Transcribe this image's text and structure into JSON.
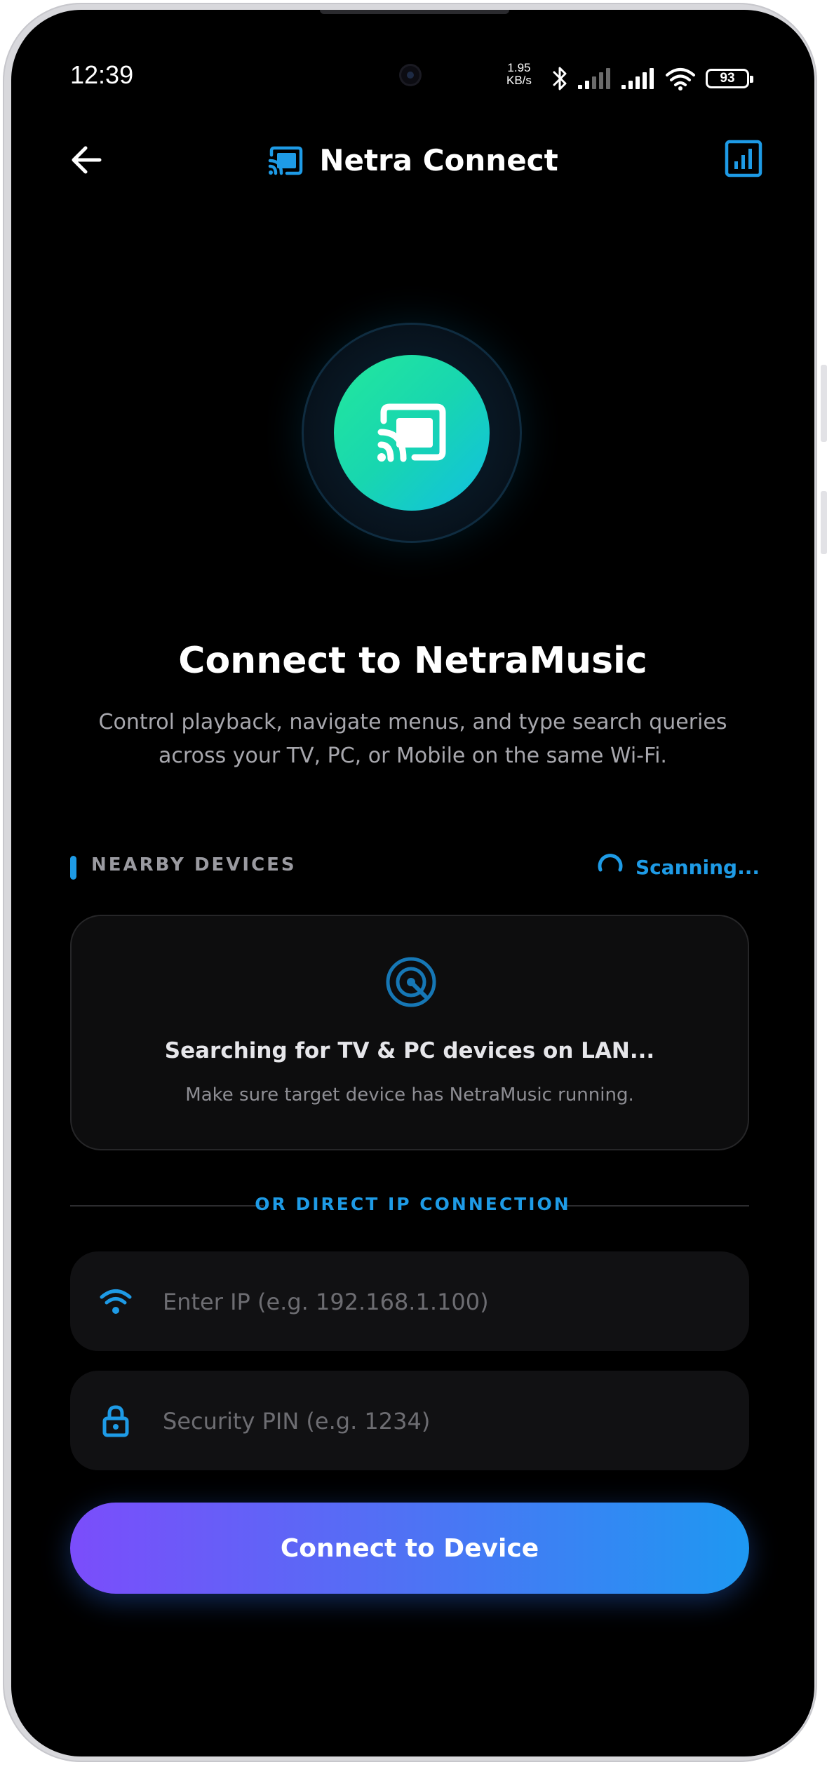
{
  "status_bar": {
    "time": "12:39",
    "net_speed_value": "1.95",
    "net_speed_unit": "KB/s",
    "battery": "93"
  },
  "app_bar": {
    "title": "Netra Connect"
  },
  "hero": {
    "heading": "Connect to NetraMusic",
    "subtext": "Control playback, navigate menus, and type search queries across your TV, PC, or Mobile on the same Wi-Fi."
  },
  "nearby": {
    "label": "NEARBY DEVICES",
    "scanning_label": "Scanning...",
    "card_title": "Searching for TV & PC devices on LAN...",
    "card_subtitle": "Make sure target device has NetraMusic running."
  },
  "direct": {
    "divider_label": "OR DIRECT IP CONNECTION",
    "ip_placeholder": "Enter IP (e.g. 192.168.1.100)",
    "ip_value": "",
    "pin_placeholder": "Security PIN (e.g. 1234)",
    "pin_value": "",
    "connect_label": "Connect to Device"
  },
  "colors": {
    "accent": "#1e9be6",
    "hero_gradient_start": "#23e89c",
    "hero_gradient_end": "#11bfe2",
    "button_gradient_start": "#7b4dfb",
    "button_gradient_end": "#1e98f2",
    "background": "#000000"
  },
  "icons": {
    "back": "arrow-left-icon",
    "logo": "cast-icon",
    "stats": "bar-chart-icon",
    "hero": "cast-icon",
    "scanning": "spinner-icon",
    "radar": "radar-icon",
    "ip_field": "wifi-icon",
    "pin_field": "lock-icon"
  }
}
